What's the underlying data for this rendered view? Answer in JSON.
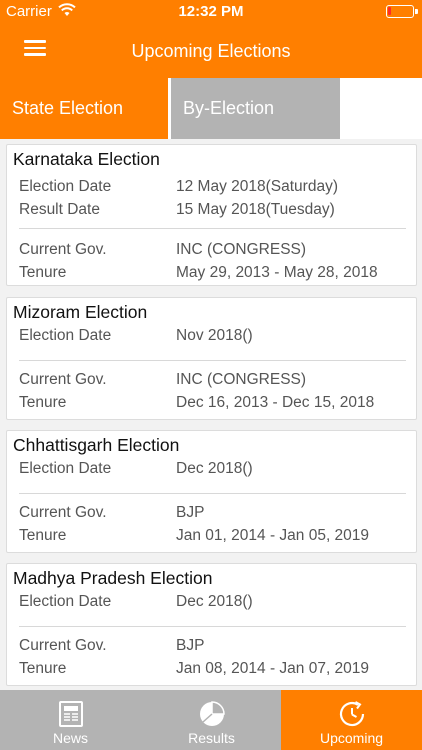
{
  "status_bar": {
    "carrier": "Carrier",
    "time": "12:32 PM",
    "battery_level": 0.12
  },
  "header": {
    "title": "Upcoming Elections",
    "menu_icon": "hamburger-menu-icon"
  },
  "tabs": [
    {
      "label": "State Election",
      "active": true
    },
    {
      "label": "By-Election",
      "active": false
    }
  ],
  "elections": [
    {
      "name": "Karnataka Election",
      "election_date_label": "Election Date",
      "election_date": "12 May 2018(Saturday)",
      "result_date_label": "Result Date",
      "result_date": "15 May 2018(Tuesday)",
      "gov_label": "Current Gov.",
      "gov": "INC (CONGRESS)",
      "tenure_label": "Tenure",
      "tenure": "May 29, 2013 - May 28, 2018"
    },
    {
      "name": "Mizoram Election",
      "election_date_label": "Election Date",
      "election_date": "Nov 2018()",
      "gov_label": "Current Gov.",
      "gov": "INC (CONGRESS)",
      "tenure_label": "Tenure",
      "tenure": "Dec 16, 2013 - Dec 15, 2018"
    },
    {
      "name": "Chhattisgarh Election",
      "election_date_label": "Election Date",
      "election_date": "Dec 2018()",
      "gov_label": "Current Gov.",
      "gov": "BJP",
      "tenure_label": "Tenure",
      "tenure": "Jan 01, 2014 - Jan 05, 2019"
    },
    {
      "name": "Madhya Pradesh Election",
      "election_date_label": "Election Date",
      "election_date": "Dec 2018()",
      "gov_label": "Current Gov.",
      "gov": "BJP",
      "tenure_label": "Tenure",
      "tenure": "Jan 08, 2014 - Jan 07, 2019"
    }
  ],
  "bottom_tabs": [
    {
      "label": "News",
      "icon": "newspaper-icon",
      "active": false
    },
    {
      "label": "Results",
      "icon": "pie-chart-icon",
      "active": false
    },
    {
      "label": "Upcoming",
      "icon": "clock-refresh-icon",
      "active": true
    }
  ],
  "colors": {
    "accent": "#ff7f00",
    "inactive": "#b3b3b3",
    "battery": "#ff2a2a"
  }
}
